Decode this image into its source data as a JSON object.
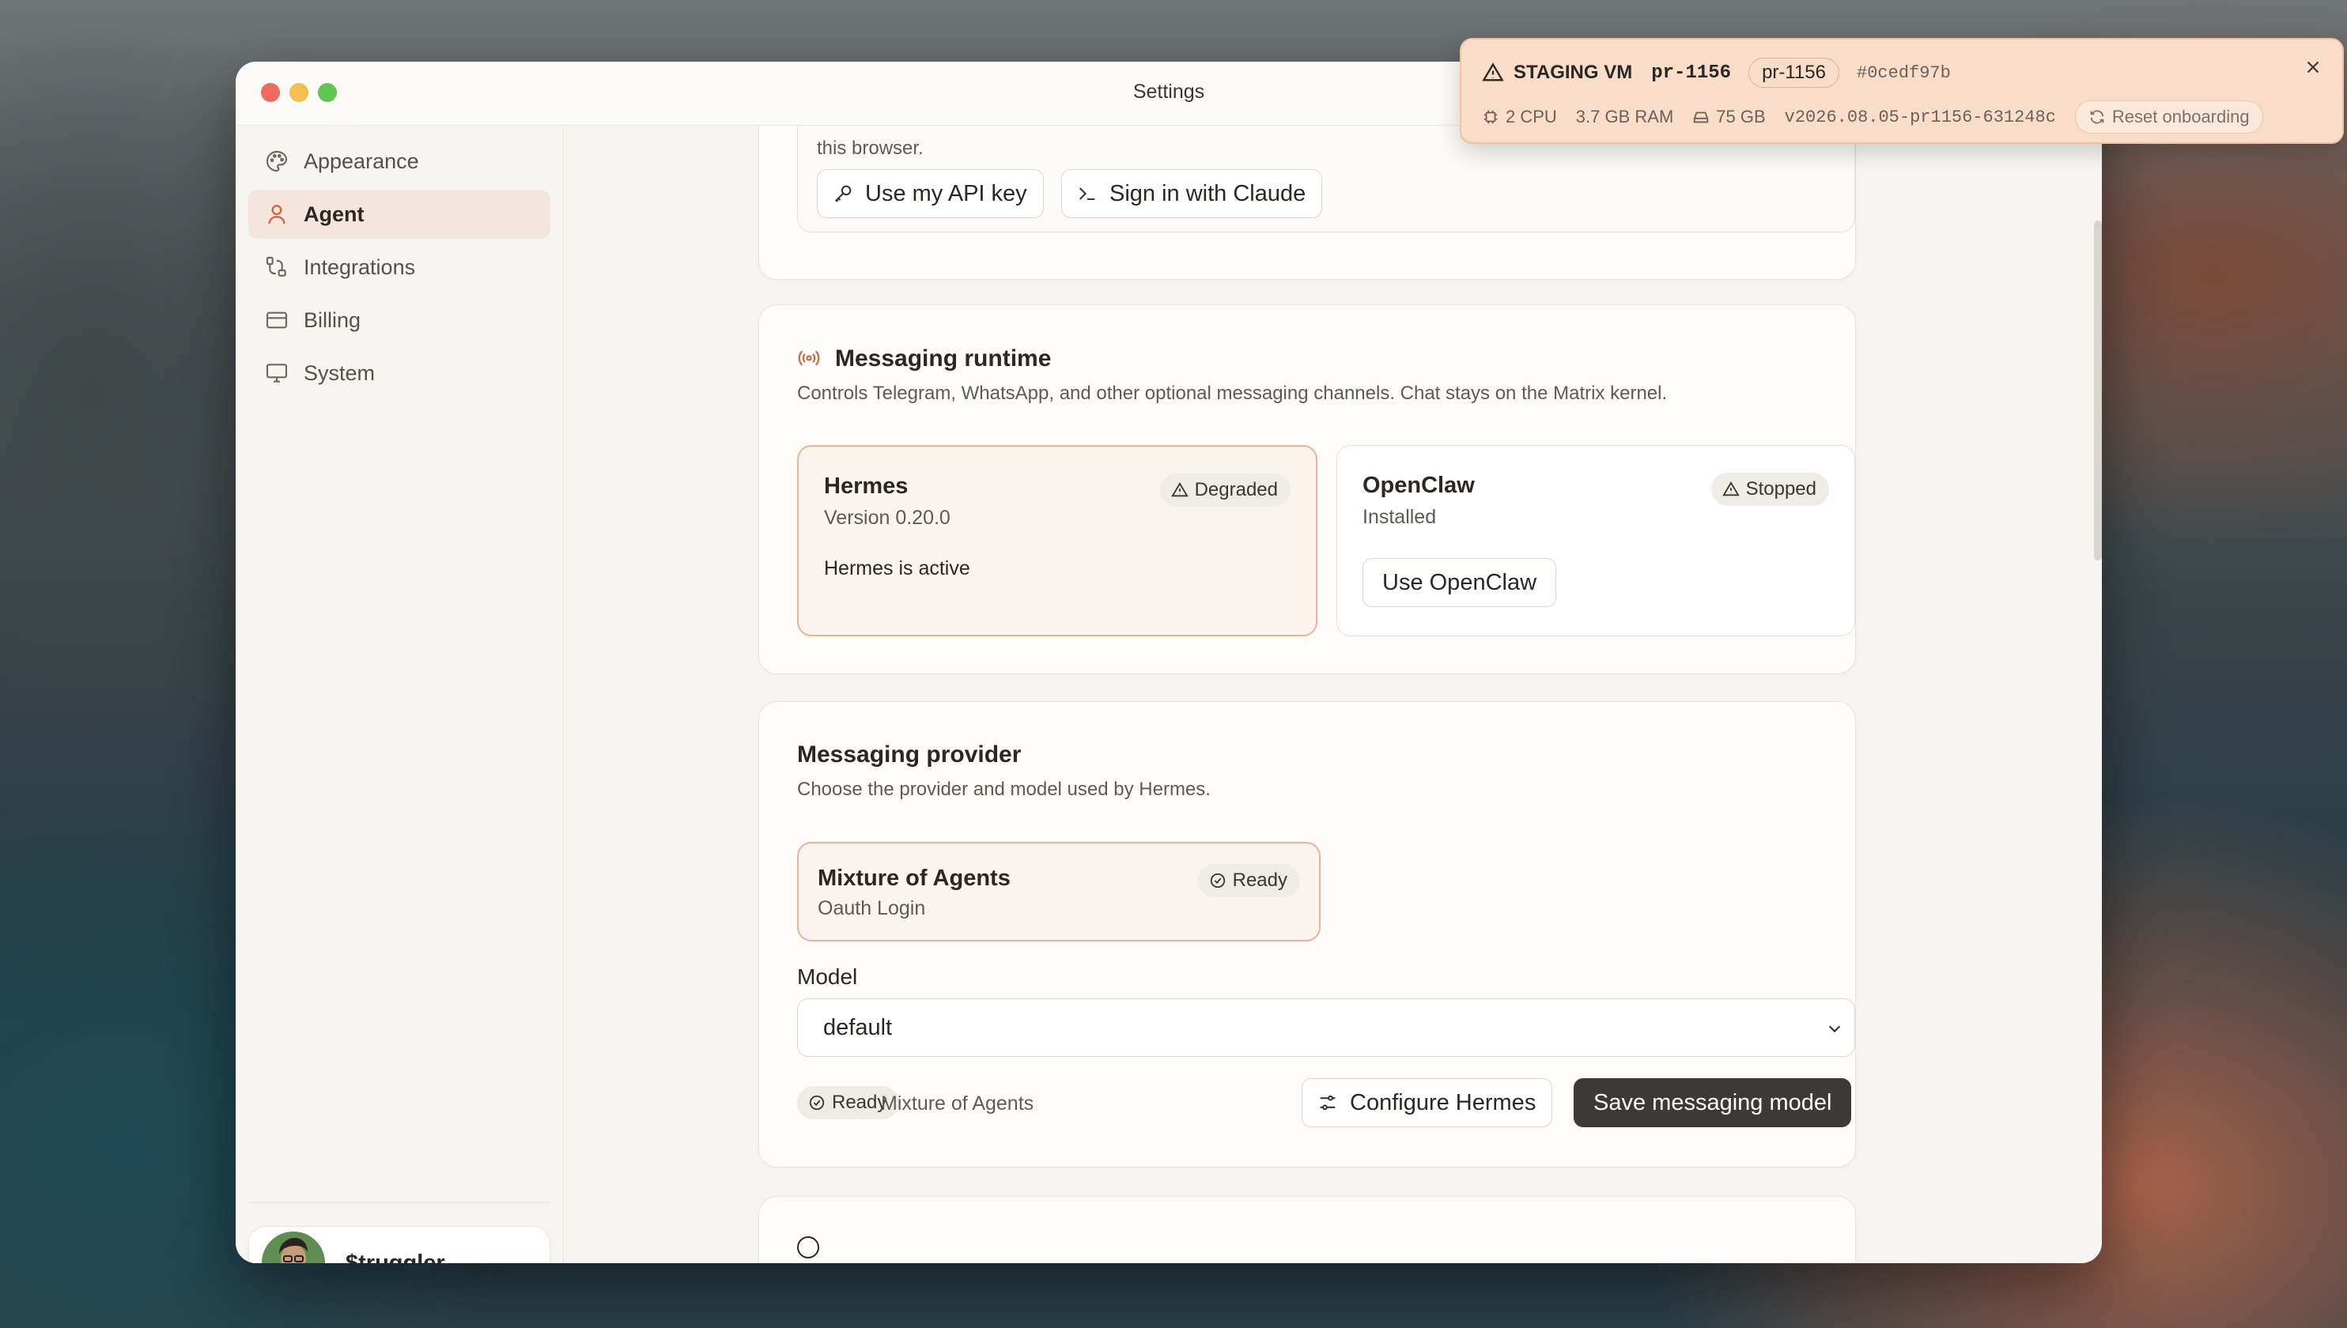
{
  "window": {
    "title": "Settings"
  },
  "sidebar": {
    "items": [
      {
        "label": "Appearance",
        "icon": "palette-icon"
      },
      {
        "label": "Agent",
        "icon": "person-icon",
        "active": true
      },
      {
        "label": "Integrations",
        "icon": "integrations-icon"
      },
      {
        "label": "Billing",
        "icon": "credit-card-icon"
      },
      {
        "label": "System",
        "icon": "monitor-icon"
      }
    ],
    "user": {
      "name": "$truggler"
    }
  },
  "auth_card": {
    "text_fragment": "this browser.",
    "api_key_button": "Use my API key",
    "claude_button": "Sign in with Claude"
  },
  "runtime": {
    "title": "Messaging runtime",
    "subtitle": "Controls Telegram, WhatsApp, and other optional messaging channels. Chat stays on the Matrix kernel.",
    "hermes": {
      "name": "Hermes",
      "version": "Version 0.20.0",
      "badge": "Degraded",
      "status": "Hermes is active"
    },
    "openclaw": {
      "name": "OpenClaw",
      "sub": "Installed",
      "badge": "Stopped",
      "button": "Use OpenClaw"
    }
  },
  "provider": {
    "title": "Messaging provider",
    "subtitle": "Choose the provider and model used by Hermes.",
    "tile": {
      "name": "Mixture of Agents",
      "sub": "Oauth Login",
      "badge": "Ready"
    },
    "model_label": "Model",
    "model_value": "default",
    "footer_badge": "Ready",
    "footer_text": "Mixture of Agents",
    "configure_button": "Configure Hermes",
    "save_button": "Save messaging model"
  },
  "banner": {
    "title": "STAGING VM",
    "pr": "pr-1156",
    "pr_pill": "pr-1156",
    "commit": "#0cedf97b",
    "cpu": "2 CPU",
    "ram": "3.7 GB RAM",
    "disk": "75 GB",
    "version": "v2026.08.05-pr1156-631248c",
    "reset": "Reset onboarding"
  },
  "colors": {
    "accent": "#d4673c",
    "selected_tile": "#fbf3ee",
    "banner_bg": "#f9ddc9",
    "dark_button": "#3c3a38"
  }
}
